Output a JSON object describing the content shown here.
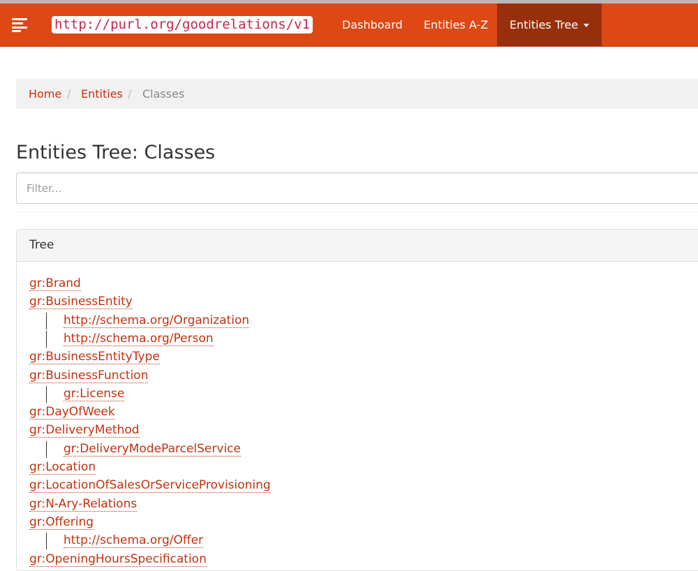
{
  "navbar": {
    "brand": "http://purl.org/goodrelations/v1",
    "links": {
      "dashboard": "Dashboard",
      "entities_az": "Entities A-Z",
      "entities_tree": "Entities Tree"
    }
  },
  "breadcrumb": {
    "home": "Home",
    "entities": "Entities",
    "current": "Classes",
    "separator": "/"
  },
  "page": {
    "title": "Entities Tree: Classes",
    "filter_placeholder": "Filter..."
  },
  "panel": {
    "heading": "Tree"
  },
  "tree": [
    {
      "label": "gr:Brand",
      "level": 0
    },
    {
      "label": "gr:BusinessEntity",
      "level": 0
    },
    {
      "label": "http://schema.org/Organization",
      "level": 1
    },
    {
      "label": "http://schema.org/Person",
      "level": 1
    },
    {
      "label": "gr:BusinessEntityType",
      "level": 0
    },
    {
      "label": "gr:BusinessFunction",
      "level": 0
    },
    {
      "label": "gr:License",
      "level": 1
    },
    {
      "label": "gr:DayOfWeek",
      "level": 0
    },
    {
      "label": "gr:DeliveryMethod",
      "level": 0
    },
    {
      "label": "gr:DeliveryModeParcelService",
      "level": 1
    },
    {
      "label": "gr:Location",
      "level": 0
    },
    {
      "label": "gr:LocationOfSalesOrServiceProvisioning",
      "level": 0
    },
    {
      "label": "gr:N-Ary-Relations",
      "level": 0
    },
    {
      "label": "gr:Offering",
      "level": 0
    },
    {
      "label": "http://schema.org/Offer",
      "level": 1
    },
    {
      "label": "gr:OpeningHoursSpecification",
      "level": 0
    }
  ],
  "colors": {
    "navbar": "#dd4814",
    "navbar_active": "#972f0c",
    "link": "#c2310f",
    "brand_code": "#c7254e"
  }
}
